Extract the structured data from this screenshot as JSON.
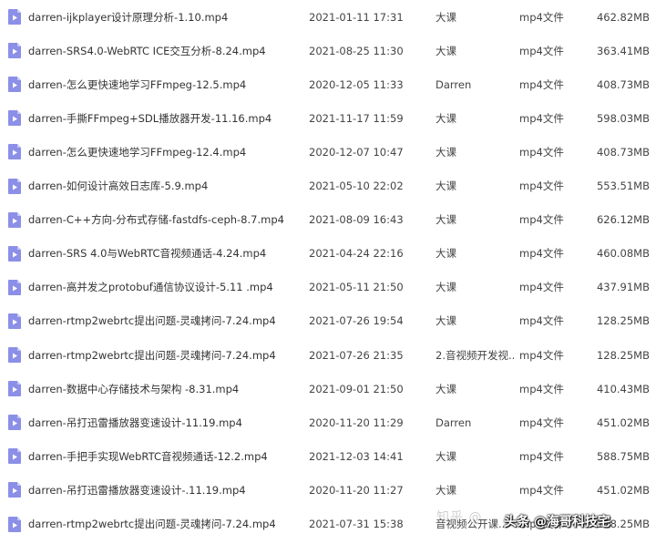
{
  "files": [
    {
      "name": "darren-ijkplayer设计原理分析-1.10.mp4",
      "date": "2021-01-11 17:31",
      "owner": "大课",
      "type": "mp4文件",
      "size": "462.82MB"
    },
    {
      "name": "darren-SRS4.0-WebRTC ICE交互分析-8.24.mp4",
      "date": "2021-08-25 11:30",
      "owner": "大课",
      "type": "mp4文件",
      "size": "363.41MB"
    },
    {
      "name": "darren-怎么更快速地学习FFmpeg-12.5.mp4",
      "date": "2020-12-05 11:33",
      "owner": "Darren",
      "type": "mp4文件",
      "size": "408.73MB"
    },
    {
      "name": "darren-手撕FFmpeg+SDL播放器开发-11.16.mp4",
      "date": "2021-11-17 11:59",
      "owner": "大课",
      "type": "mp4文件",
      "size": "598.03MB"
    },
    {
      "name": "darren-怎么更快速地学习FFmpeg-12.4.mp4",
      "date": "2020-12-07 10:47",
      "owner": "大课",
      "type": "mp4文件",
      "size": "408.73MB"
    },
    {
      "name": "darren-如何设计高效日志库-5.9.mp4",
      "date": "2021-05-10 22:02",
      "owner": "大课",
      "type": "mp4文件",
      "size": "553.51MB"
    },
    {
      "name": "darren-C++方向-分布式存储-fastdfs-ceph-8.7.mp4",
      "date": "2021-08-09 16:43",
      "owner": "大课",
      "type": "mp4文件",
      "size": "626.12MB"
    },
    {
      "name": "darren-SRS 4.0与WebRTC音视频通话-4.24.mp4",
      "date": "2021-04-24 22:16",
      "owner": "大课",
      "type": "mp4文件",
      "size": "460.08MB"
    },
    {
      "name": "darren-高并发之protobuf通信协议设计-5.11 .mp4",
      "date": "2021-05-11 21:50",
      "owner": "大课",
      "type": "mp4文件",
      "size": "437.91MB"
    },
    {
      "name": "darren-rtmp2webrtc提出问题-灵魂拷问-7.24.mp4",
      "date": "2021-07-26 19:54",
      "owner": "大课",
      "type": "mp4文件",
      "size": "128.25MB"
    },
    {
      "name": "darren-rtmp2webrtc提出问题-灵魂拷问-7.24.mp4",
      "date": "2021-07-26 21:35",
      "owner": "2.音视频开发视...",
      "type": "mp4文件",
      "size": "128.25MB"
    },
    {
      "name": "darren-数据中心存储技术与架构 -8.31.mp4",
      "date": "2021-09-01 21:50",
      "owner": "大课",
      "type": "mp4文件",
      "size": "410.43MB"
    },
    {
      "name": "darren-吊打迅雷播放器变速设计-11.19.mp4",
      "date": "2020-11-20 11:29",
      "owner": "Darren",
      "type": "mp4文件",
      "size": "451.02MB"
    },
    {
      "name": "darren-手把手实现WebRTC音视频通话-12.2.mp4",
      "date": "2021-12-03 14:41",
      "owner": "大课",
      "type": "mp4文件",
      "size": "588.75MB"
    },
    {
      "name": "darren-吊打迅雷播放器变速设计-.11.19.mp4",
      "date": "2020-11-20 11:27",
      "owner": "大课",
      "type": "mp4文件",
      "size": "451.02MB"
    },
    {
      "name": "darren-rtmp2webrtc提出问题-灵魂拷问-7.24.mp4",
      "date": "2021-07-31 15:38",
      "owner": "音视频公开课...",
      "type": "mp4文件",
      "size": "128.25MB"
    }
  ],
  "watermark": {
    "faint_text": "知乎 @",
    "tag_text": "头条 @海哥科技宅"
  },
  "colors": {
    "icon_fill": "#8b8fe8",
    "icon_fold": "#c3c5f3",
    "icon_play": "#ffffff",
    "text": "#333333"
  }
}
